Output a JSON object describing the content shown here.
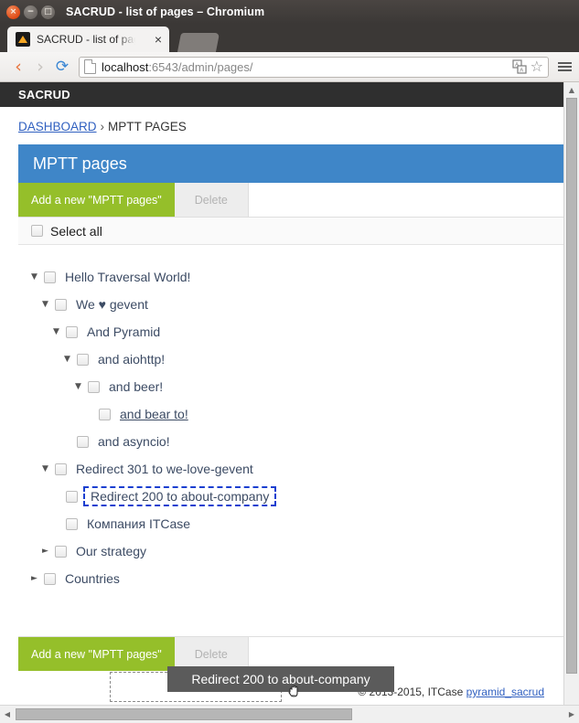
{
  "window": {
    "title": "SACRUD - list of pages – Chromium",
    "buttons": {
      "close": "×",
      "minimize": "−",
      "maximize": "□"
    }
  },
  "tab": {
    "title": "SACRUD - list of pag",
    "close_label": "×",
    "favicon_name": "pyramid-favicon"
  },
  "navbar": {
    "back_glyph": "‹",
    "forward_glyph": "›",
    "reload_glyph": "⟳",
    "url_host": "localhost",
    "url_rest": ":6543/admin/pages/",
    "url_full": "localhost:6543/admin/pages/",
    "star_glyph": "☆",
    "translate_label": "translate-icon",
    "menu_label": "chrome-menu"
  },
  "site": {
    "brand": "SACRUD"
  },
  "breadcrumb": {
    "home": "DASHBOARD",
    "separator": "›",
    "current": "MPTT PAGES"
  },
  "panel": {
    "title": "MPTT pages",
    "header_color": "#3f86c8",
    "add_label": "Add a new \"MPTT pages\"",
    "add_color": "#95bf2a",
    "delete_label": "Delete",
    "delete_disabled": true
  },
  "list": {
    "select_all_label": "Select all"
  },
  "tree": {
    "arrow_open": "▼",
    "arrow_closed": "►",
    "nodes": [
      {
        "label": "Hello Traversal World!",
        "depth": 0,
        "arrow": "open",
        "state": "normal"
      },
      {
        "label": "We ♥ gevent",
        "depth": 1,
        "arrow": "open",
        "state": "normal"
      },
      {
        "label": "And Pyramid",
        "depth": 2,
        "arrow": "open",
        "state": "normal"
      },
      {
        "label": "and aiohttp!",
        "depth": 3,
        "arrow": "open",
        "state": "normal"
      },
      {
        "label": "and beer!",
        "depth": 4,
        "arrow": "open",
        "state": "normal"
      },
      {
        "label": "and bear to!",
        "depth": 5,
        "arrow": "none",
        "state": "hovered"
      },
      {
        "label": "and asyncio!",
        "depth": 3,
        "arrow": "none",
        "state": "normal"
      },
      {
        "label": "Redirect 301 to we-love-gevent",
        "depth": 1,
        "arrow": "open",
        "state": "normal"
      },
      {
        "label": "Redirect 200 to about-company",
        "depth": 2,
        "arrow": "none",
        "state": "drag-source"
      },
      {
        "label": "Компания ITCase",
        "depth": 2,
        "arrow": "none",
        "state": "normal"
      },
      {
        "label": "Our strategy",
        "depth": 1,
        "arrow": "closed",
        "state": "normal"
      },
      {
        "label": "Countries",
        "depth": 0,
        "arrow": "closed",
        "state": "normal"
      }
    ]
  },
  "drag": {
    "ghost_label": "Redirect 200 to about-company",
    "ghost_bg": "#5b5b5b",
    "placeholder_name": "drop-placeholder",
    "cursor": "grabbing-hand"
  },
  "footer": {
    "copyright": "© 2013-2015, ITCase",
    "link": "pyramid_sacrud"
  },
  "scrollbars": {
    "v_up": "▲",
    "h_left": "◀",
    "h_right": "▶"
  }
}
